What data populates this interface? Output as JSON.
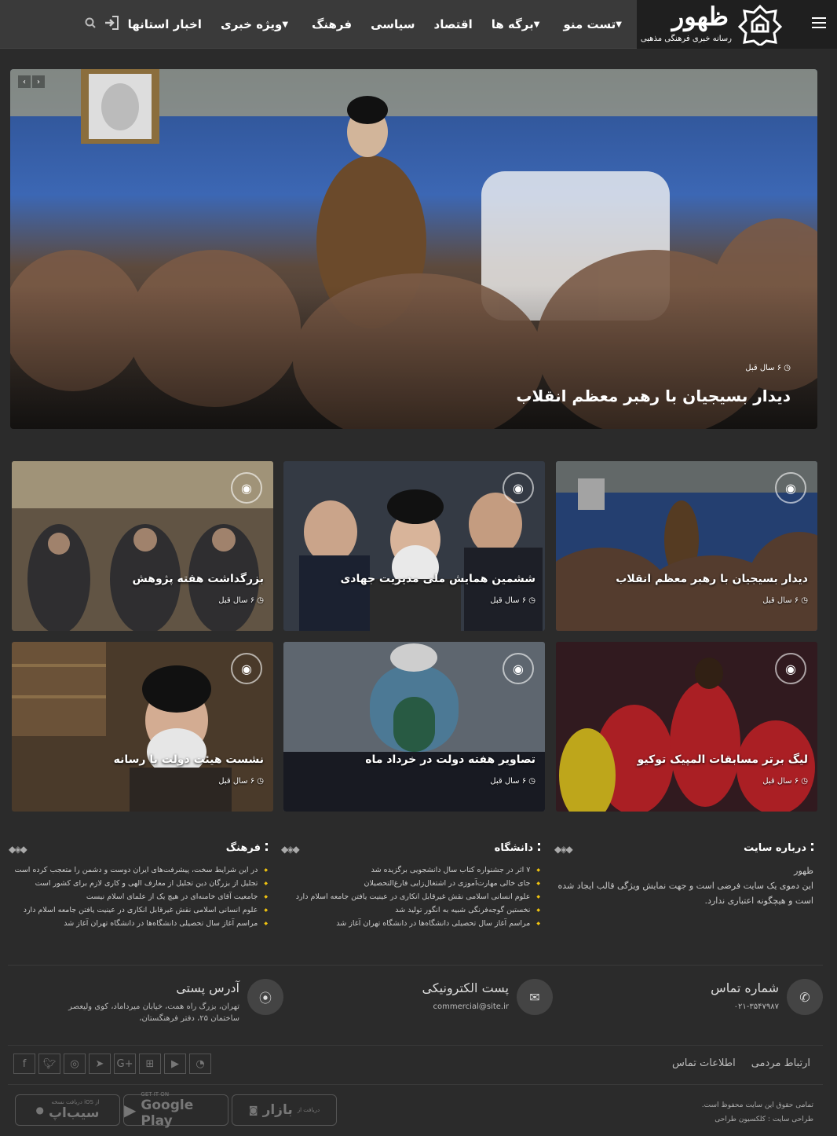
{
  "header": {
    "logo_title": "ظهور",
    "logo_subtitle": "رسانه خبری فرهنگی مذهبی",
    "nav": [
      {
        "label": "تست منو",
        "has_dropdown": true
      },
      {
        "label": "برگه ها",
        "has_dropdown": true
      },
      {
        "label": "اقتصاد",
        "has_dropdown": false
      },
      {
        "label": "سیاسی",
        "has_dropdown": false
      },
      {
        "label": "فرهنگ",
        "has_dropdown": false
      },
      {
        "label": "ویژه خبری",
        "has_dropdown": true
      },
      {
        "label": "اخبار استانها",
        "has_dropdown": false
      }
    ],
    "icons": [
      "hamburger-icon",
      "login-icon",
      "search-icon"
    ]
  },
  "hero": {
    "meta": "۶ سال قبل",
    "title": "دیدار بسیجیان با رهبر معظم انقلاب"
  },
  "cards": [
    {
      "title": "دیدار بسیجیان با رهبر معظم انقلاب",
      "meta": "۶ سال قبل"
    },
    {
      "title": "ششمین همایش ملی مدیریت جهادی",
      "meta": "۶ سال قبل"
    },
    {
      "title": "بزرگداشت هفته پژوهش",
      "meta": "۶ سال قبل"
    },
    {
      "title": "لیگ برتر مسابقات المپیک توکیو",
      "meta": "۶ سال قبل"
    },
    {
      "title": "تصاویر هفته دولت در خرداد ماه",
      "meta": "۶ سال قبل"
    },
    {
      "title": "نشست هیئت دولت با رسانه",
      "meta": "۶ سال قبل"
    }
  ],
  "widgets": {
    "about": {
      "title": "درباره سایت",
      "brand": "ظهور",
      "text": "این دموی یک سایت فرضی است و جهت نمایش ویژگی قالب ایجاد شده است و هیچگونه اعتباری ندارد."
    },
    "university": {
      "title": "دانشگاه",
      "items": [
        "۷ اثر در جشنواره کتاب سال دانشجویی برگزیده شد",
        "جای خالی مهارت‌آموزی در اشتغال‌زایی فارغ‌التحصیلان",
        "علوم انسانی اسلامی نقش غیرقابل انکاری در عینیت یافتن جامعه اسلام دارد",
        "نخستین گوجه‌فرنگی شبیه به انگور تولید شد",
        "مراسم آغاز سال تحصیلی دانشگاه‌ها در دانشگاه تهران آغاز شد"
      ]
    },
    "culture": {
      "title": "فرهنگ",
      "items": [
        "در این شرایط سخت، پیشرفت‌های ایران دوست و دشمن را متعجب کرده است",
        "تجلیل از بزرگان دین تجلیل از معارف الهی و کاری لازم برای کشور است",
        "جامعیت آقای خامنه‌ای در هیچ یک از علمای اسلام نیست",
        "علوم انسانی اسلامی نقش غیرقابل انکاری در عینیت یافتن جامعه اسلام دارد",
        "مراسم آغاز سال تحصیلی دانشگاه‌ها در دانشگاه تهران آغاز شد"
      ]
    }
  },
  "contact": {
    "phone": {
      "title": "شماره تماس",
      "value": "۰۲۱-۳۵۴۷۹۸۷"
    },
    "email": {
      "title": "پست الکترونیکی",
      "value": "commercial@site.ir"
    },
    "address": {
      "title": "آدرس پستی",
      "line1": "تهران، بزرگ راه همت، خیابان میرداماد، کوی ولیعصر",
      "line2": "ساختمان ۲۵، دفتر فرهنگستان،"
    }
  },
  "bottom_links": [
    "ارتباط مردمی",
    "اطلاعات تماس"
  ],
  "social_icons": [
    "facebook-icon",
    "twitter-icon",
    "instagram-icon",
    "telegram-icon",
    "google-plus-icon",
    "windows-icon",
    "youtube-icon",
    "rss-icon"
  ],
  "badges": {
    "bazaar": {
      "small": "دریافت از",
      "big": "بازار"
    },
    "google_play": {
      "small": "GET IT ON",
      "big": "Google Play"
    },
    "sibapp": {
      "small": "دریافت نسخه iOS از",
      "big": "سیب‌اپ"
    }
  },
  "copyright": {
    "line1": "تمامی حقوق این سایت محفوظ است.",
    "line2": "طراحی سایت : کلکسیون طراحی"
  }
}
